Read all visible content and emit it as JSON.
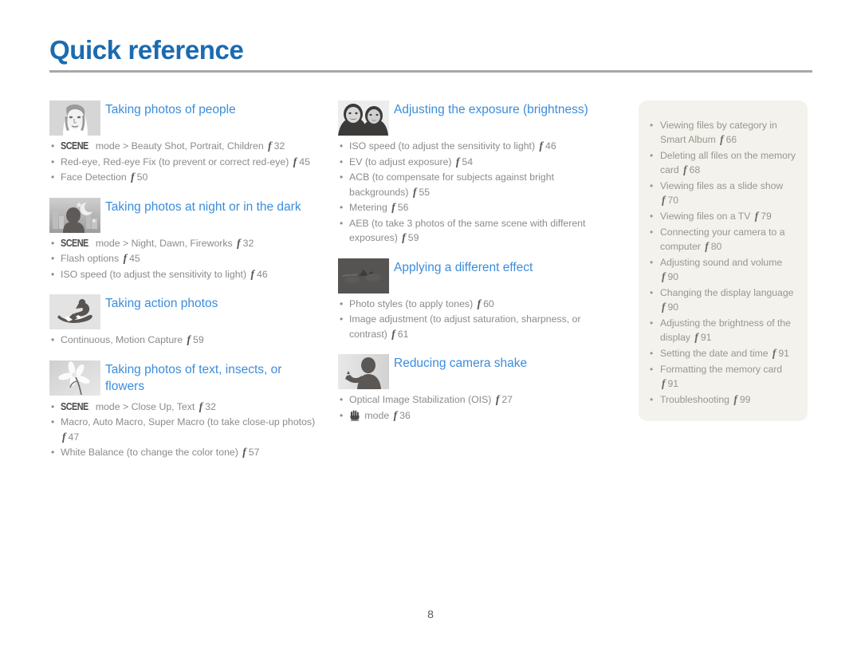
{
  "document": {
    "title": "Quick reference",
    "page_number": "8",
    "accent_color": "#1b6bb0",
    "link_color": "#3b8ddb",
    "body_color": "#8b8b8b",
    "panel_background": "#f4f2ec",
    "rule_color": "#a9a9a9",
    "ref_glyph": "f"
  },
  "columns": {
    "left": [
      {
        "id": "taking-photos-of-people",
        "icon": "portrait-woman-thumbnail",
        "title": "Taking photos of people",
        "bullets": [
          {
            "scene": "SCENE",
            "text": "mode > Beauty Shot, Portrait, Children",
            "page": "32"
          },
          {
            "text": "Red-eye, Red-eye Fix (to prevent or correct red-eye)",
            "page": "45"
          },
          {
            "text": "Face Detection",
            "page": "50"
          }
        ]
      },
      {
        "id": "taking-photos-at-night",
        "icon": "night-scene-thumbnail",
        "title": "Taking photos at night or in the dark",
        "bullets": [
          {
            "scene": "SCENE",
            "text": "mode > Night, Dawn, Fireworks",
            "page": "32"
          },
          {
            "text": "Flash options",
            "page": "45"
          },
          {
            "text": "ISO speed (to adjust the sensitivity to light)",
            "page": "46"
          }
        ]
      },
      {
        "id": "taking-action-photos",
        "icon": "snowboarder-thumbnail",
        "title": "Taking action photos",
        "bullets": [
          {
            "text": "Continuous, Motion Capture",
            "page": "59"
          }
        ]
      },
      {
        "id": "taking-photos-of-text-insects-flowers",
        "icon": "flower-macro-thumbnail",
        "title": "Taking photos of text, insects, or flowers",
        "bullets": [
          {
            "scene": "SCENE",
            "text": "mode > Close Up, Text",
            "page": "32"
          },
          {
            "text": "Macro, Auto Macro, Super Macro (to take close-up photos)",
            "page": "47"
          },
          {
            "text": "White Balance (to change the color tone)",
            "page": "57"
          }
        ]
      }
    ],
    "middle": [
      {
        "id": "adjusting-the-exposure",
        "icon": "two-faces-thumbnail",
        "title": "Adjusting the exposure (brightness)",
        "bullets": [
          {
            "text": "ISO speed (to adjust the sensitivity to light)",
            "page": "46"
          },
          {
            "text": "EV (to adjust exposure)",
            "page": "54"
          },
          {
            "text": "ACB (to compensate for subjects against bright backgrounds)",
            "page": "55"
          },
          {
            "text": "Metering",
            "page": "56"
          },
          {
            "text": "AEB (to take 3 photos of the same scene with different exposures)",
            "page": "59"
          }
        ]
      },
      {
        "id": "applying-a-different-effect",
        "icon": "dark-landscape-thumbnail",
        "title": "Applying a different effect",
        "bullets": [
          {
            "text": "Photo styles (to apply tones)",
            "page": "60"
          },
          {
            "text": "Image adjustment (to adjust saturation, sharpness, or contrast)",
            "page": "61"
          }
        ]
      },
      {
        "id": "reducing-camera-shake",
        "icon": "person-waving-thumbnail",
        "title": "Reducing camera shake",
        "bullets": [
          {
            "text": "Optical Image Stabilization (OIS)",
            "page": "27"
          },
          {
            "shake_icon": true,
            "text": "mode",
            "page": "36"
          }
        ]
      }
    ],
    "right": [
      {
        "text": "Viewing files by category in Smart Album",
        "page": "66"
      },
      {
        "text": "Deleting all files on the memory card",
        "page": "68"
      },
      {
        "text": "Viewing files as a slide show",
        "page": "70"
      },
      {
        "text": "Viewing files on a TV",
        "page": "79"
      },
      {
        "text": "Connecting your camera to a computer",
        "page": "80"
      },
      {
        "text": "Adjusting sound and volume",
        "page": "90"
      },
      {
        "text": "Changing the display language",
        "page": "90"
      },
      {
        "text": "Adjusting the brightness of the display",
        "page": "91"
      },
      {
        "text": "Setting the date and time",
        "page": "91"
      },
      {
        "text": "Formatting the memory card",
        "page": "91"
      },
      {
        "text": "Troubleshooting",
        "page": "99"
      }
    ]
  }
}
